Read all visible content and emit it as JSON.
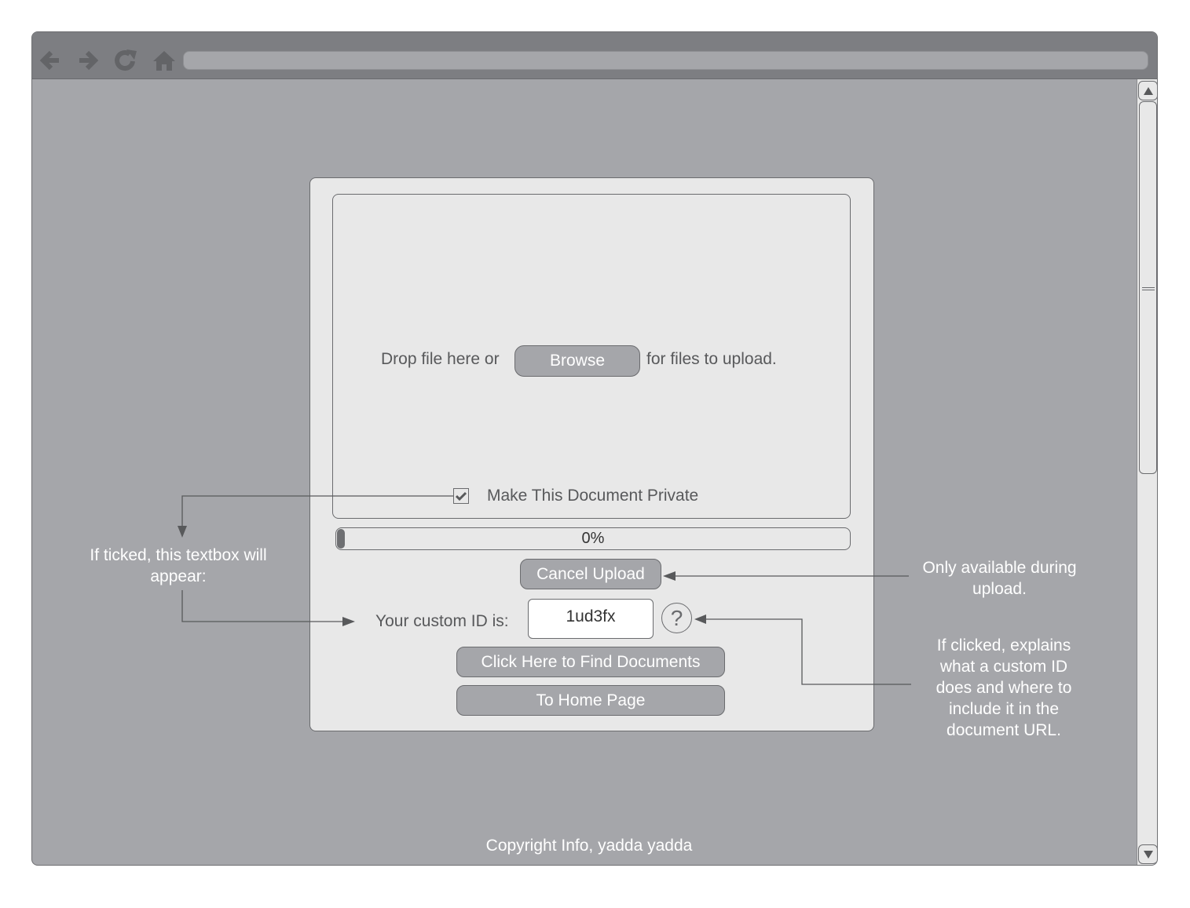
{
  "browser": {
    "toolbar": {
      "icons": [
        "back-arrow-icon",
        "forward-arrow-icon",
        "reload-icon",
        "home-icon"
      ],
      "address_value": ""
    },
    "scrollbar": {
      "up_icon": "triangle-up-icon",
      "down_icon": "triangle-down-icon"
    }
  },
  "upload": {
    "drop_text_before": "Drop file here or",
    "browse_label": "Browse",
    "drop_text_after": "for files to upload.",
    "private_checkbox": {
      "label": "Make This Document Private",
      "checked": true
    },
    "progress": {
      "percent": 0,
      "label": "0%"
    },
    "cancel_label": "Cancel Upload",
    "custom_id_label": "Your custom ID is:",
    "custom_id_value": "1ud3fx",
    "help_symbol": "?",
    "find_documents_label": "Click Here to Find Documents",
    "home_label": "To Home Page"
  },
  "annotations": {
    "private_note": "If ticked, this textbox will appear:",
    "cancel_note": "Only available during upload.",
    "help_note": "If clicked, explains what a custom ID does and where to include it in the document URL."
  },
  "footer": {
    "copyright": "Copyright Info, yadda yadda"
  },
  "colors": {
    "page_bg": "#a5a6aa",
    "toolbar_bg": "#7d7e82",
    "panel_bg": "#e8e8e8",
    "button_bg": "#a5a6aa",
    "border": "#6a6b6e"
  }
}
